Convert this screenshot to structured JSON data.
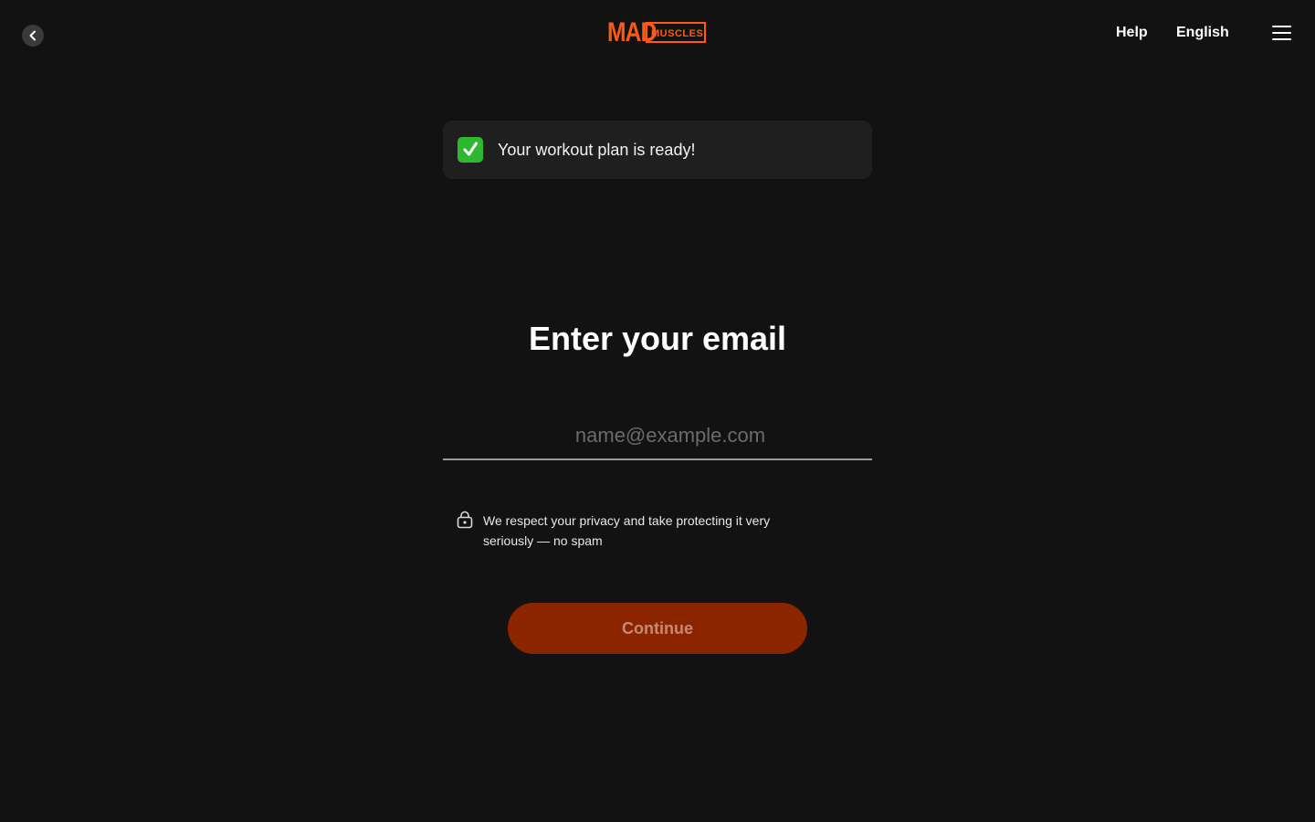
{
  "header": {
    "logo": {
      "mad": "MAD",
      "muscles": "MUSCLES"
    },
    "help_label": "Help",
    "language_label": "English"
  },
  "notice": {
    "text": "Your workout plan is ready!",
    "icon": "check-mark-button-icon"
  },
  "form": {
    "title": "Enter your email",
    "email": {
      "value": "",
      "placeholder": "name@example.com"
    },
    "privacy_text": "We respect your privacy and take protecting it very seriously — no spam",
    "continue_label": "Continue"
  },
  "colors": {
    "background": "#121212",
    "brand": "#ff5a14",
    "button_disabled": "#8b2500",
    "success": "#2fb82f"
  }
}
